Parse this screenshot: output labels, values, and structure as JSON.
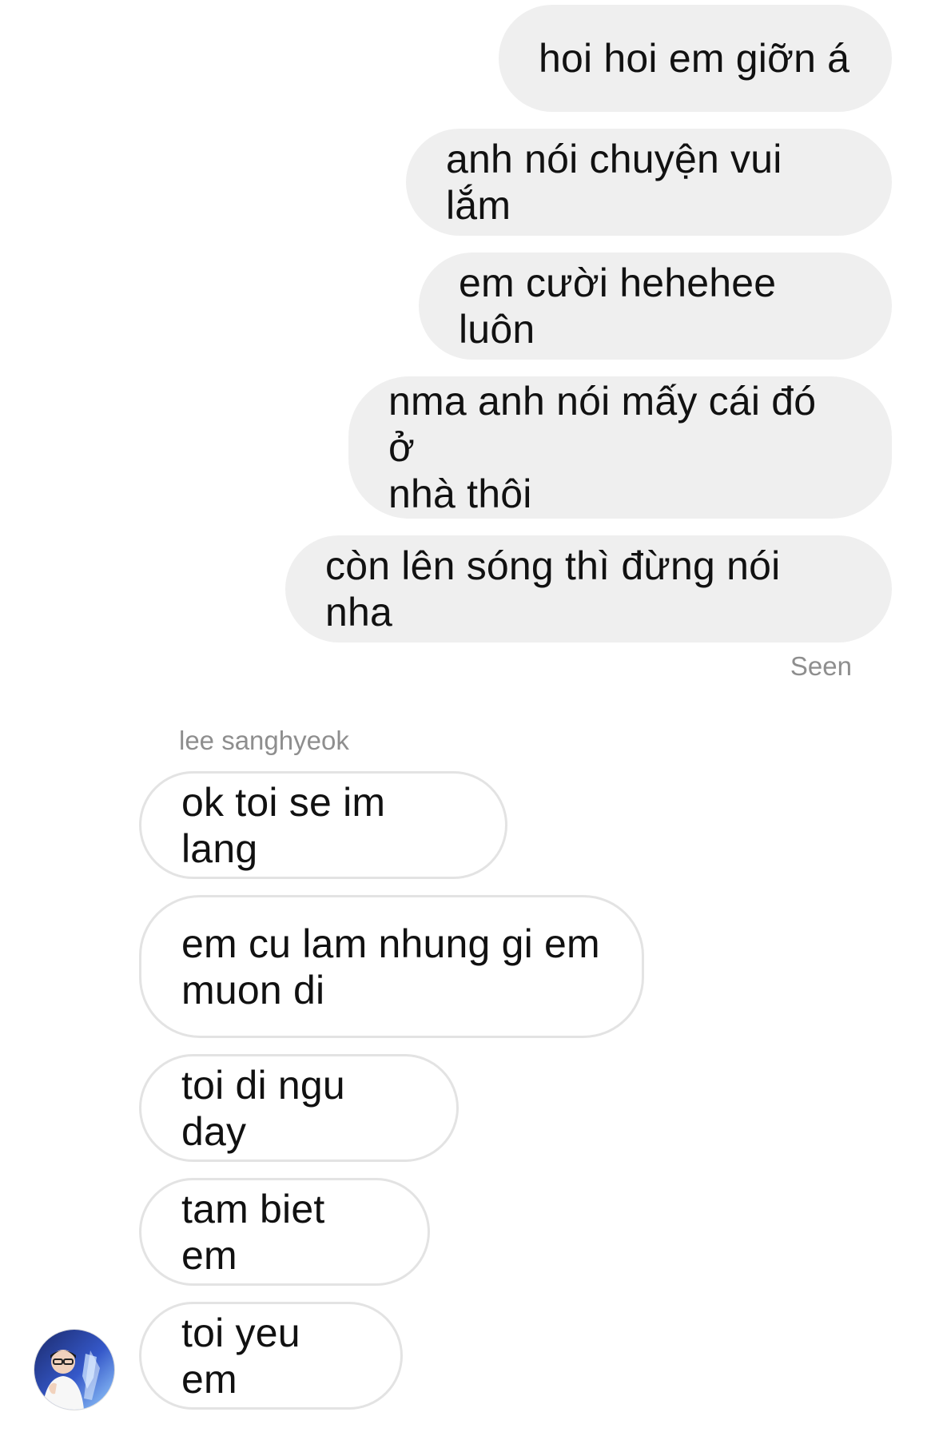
{
  "sent_messages": [
    "hoi hoi em giỡn á",
    "anh nói chuyện vui lắm",
    "em cười hehehee luôn",
    "nma anh nói mấy cái đó ở\nnhà thôi",
    "còn lên sóng thì đừng nói nha"
  ],
  "seen_label": "Seen",
  "contact": {
    "name": "lee sanghyeok",
    "avatar": "profile-photo"
  },
  "received_messages": [
    "ok toi se im lang",
    "em cu lam nhung gi em\nmuon di",
    "toi di ngu day",
    "tam biet em",
    "toi yeu em"
  ]
}
